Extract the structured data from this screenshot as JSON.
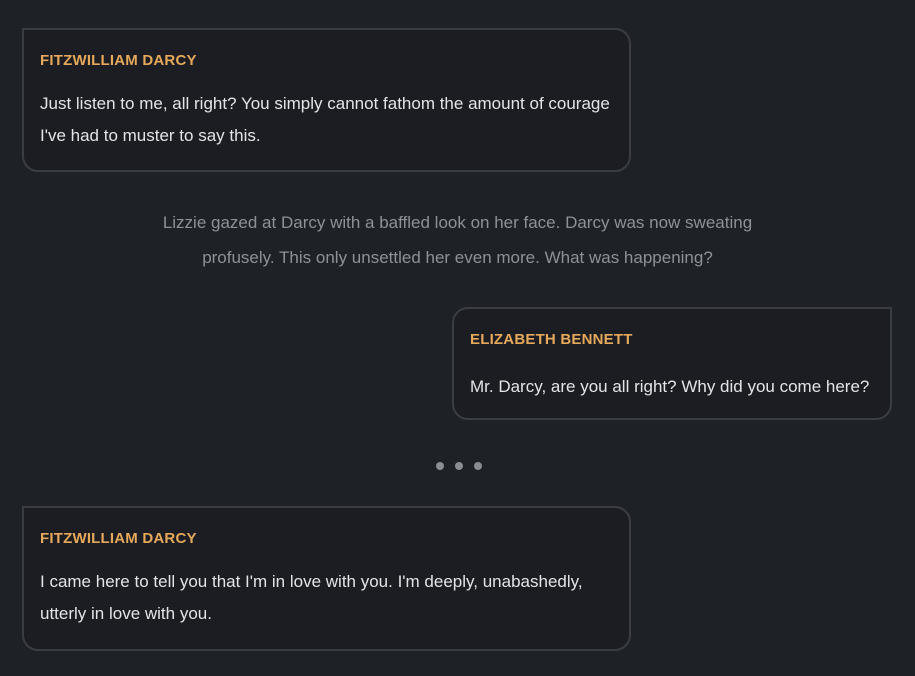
{
  "messages": [
    {
      "speaker": "FITZWILLIAM DARCY",
      "text": "Just listen to me, all right? You simply cannot fathom the amount of courage I've had to muster to say this."
    },
    {
      "speaker": "ELIZABETH BENNETT",
      "text": "Mr. Darcy, are you all right? Why did you come here?"
    },
    {
      "speaker": "FITZWILLIAM DARCY",
      "text": "I came here to tell you that I'm in love with you. I'm deeply, unabashedly, utterly in love with you."
    }
  ],
  "narration": "Lizzie gazed at Darcy with a baffled look on her face. Darcy was now sweating profusely. This only unsettled her even more. What was happening?",
  "colors": {
    "background": "#1e2125",
    "bubble_background": "#1b1d22",
    "bubble_border": "#3a3d43",
    "speaker_name": "#e6a85a",
    "dialogue_text": "#e3e4e6",
    "narration_text": "#8e9196"
  },
  "icons": {
    "typing_indicator": "ellipsis-dots-icon"
  }
}
